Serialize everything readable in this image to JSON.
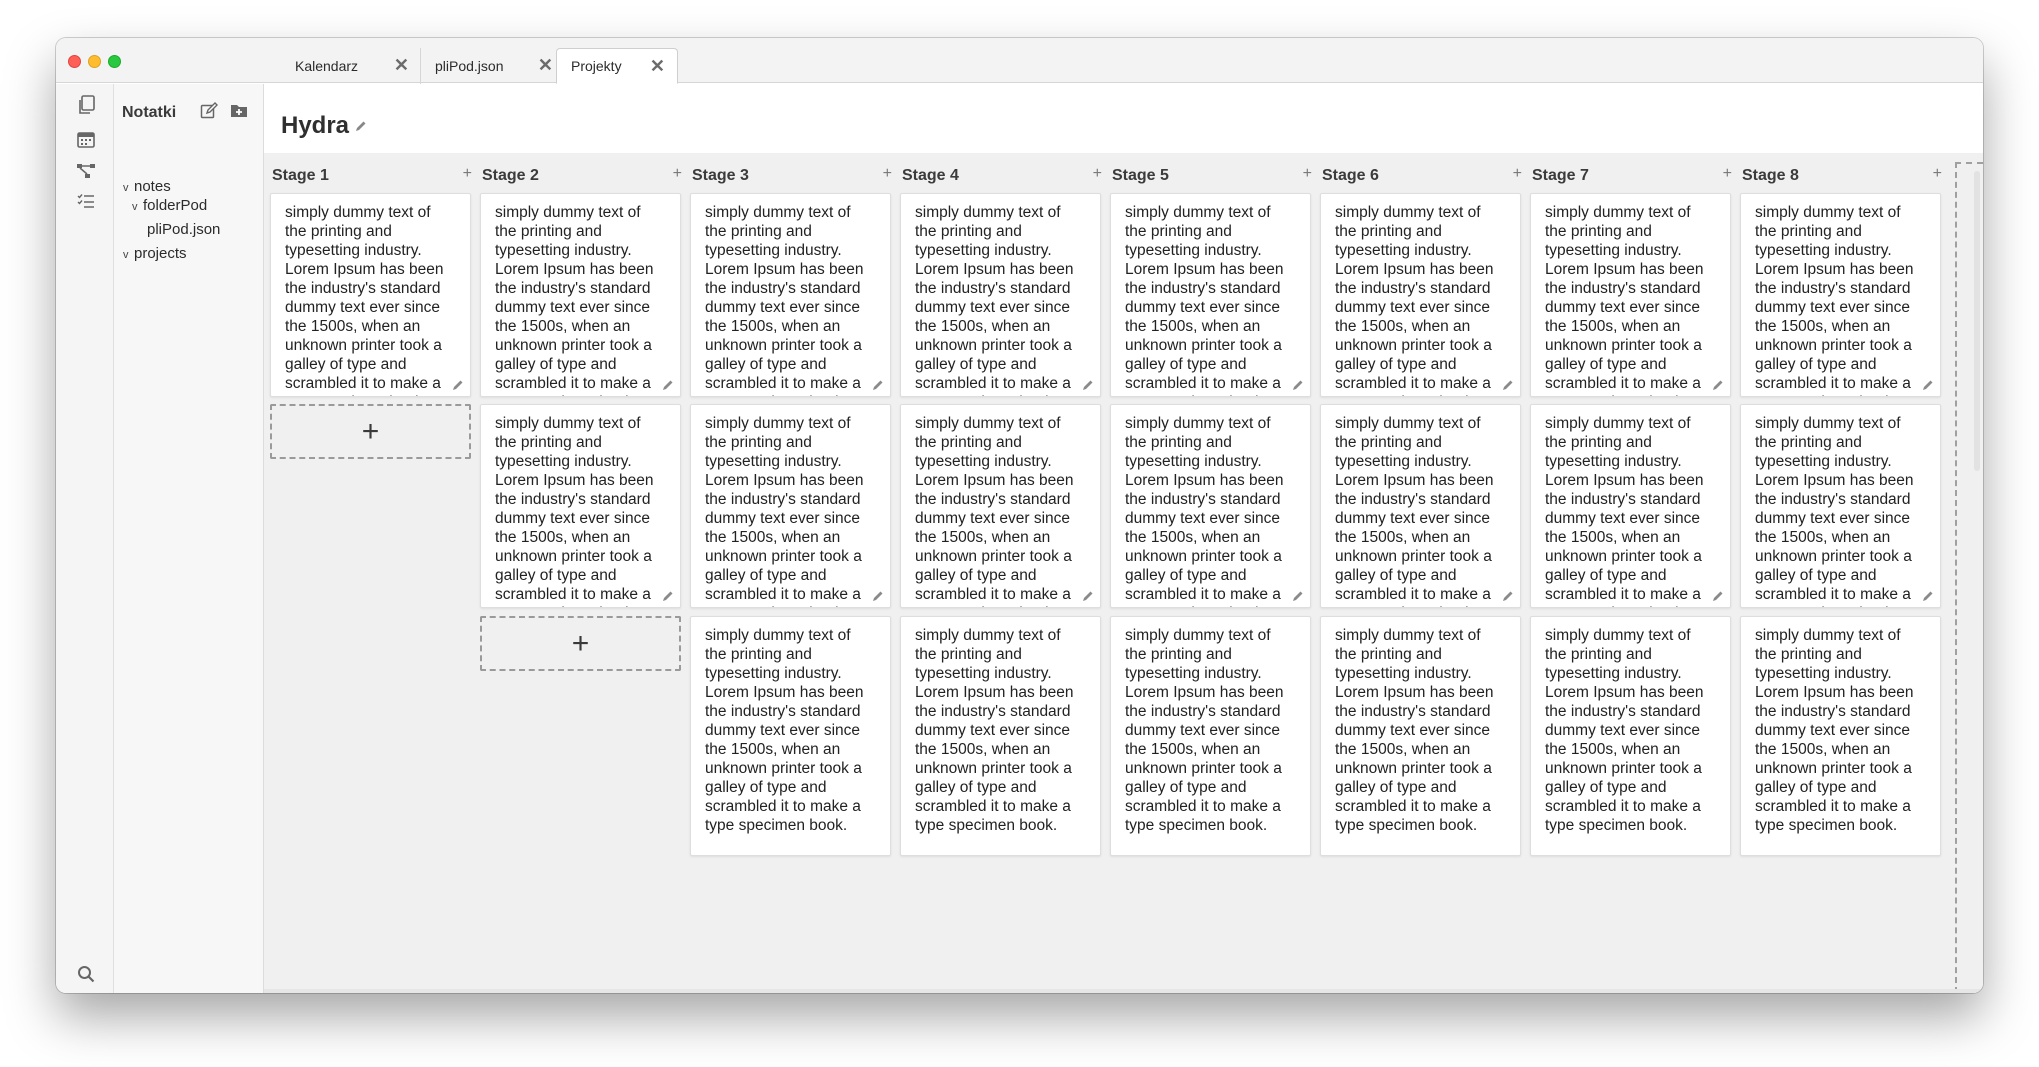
{
  "tabs": [
    {
      "label": "Kalendarz",
      "close": "✕"
    },
    {
      "label": "pliPod.json",
      "close": "✕"
    },
    {
      "label": "Projekty",
      "close": "✕"
    }
  ],
  "sidebar": {
    "title": "Notatki",
    "tree": [
      {
        "label": "notes",
        "chevron": "v"
      },
      {
        "label": "folderPod",
        "chevron": "v"
      },
      {
        "label": "pliPod.json",
        "chevron": ""
      },
      {
        "label": "projects",
        "chevron": "v"
      }
    ]
  },
  "page": {
    "title": "Hydra"
  },
  "card_text": "simply dummy text of the printing and typesetting industry. Lorem Ipsum has been the industry's standard dummy text ever since the 1500s, when an unknown printer took a galley of type and scrambled it to make a type specimen book.",
  "add_symbol": "+",
  "columns": [
    {
      "title": "Stage 1",
      "add": "+",
      "cards": 1
    },
    {
      "title": "Stage 2",
      "add": "+",
      "cards": 2
    },
    {
      "title": "Stage 3",
      "add": "+",
      "cards": 3
    },
    {
      "title": "Stage 4",
      "add": "+",
      "cards": 3
    },
    {
      "title": "Stage 5",
      "add": "+",
      "cards": 3
    },
    {
      "title": "Stage 6",
      "add": "+",
      "cards": 3
    },
    {
      "title": "Stage 7",
      "add": "+",
      "cards": 3
    },
    {
      "title": "Stage 8",
      "add": "+",
      "cards": 3
    }
  ],
  "icons": {
    "rail_top": [
      "copy-icon",
      "calendar-icon",
      "graph-icon",
      "checklist-icon"
    ],
    "rail_bottom": [
      "search-icon",
      "gear-icon"
    ],
    "sidebar_actions": [
      "edit-note-icon",
      "new-folder-icon"
    ]
  }
}
